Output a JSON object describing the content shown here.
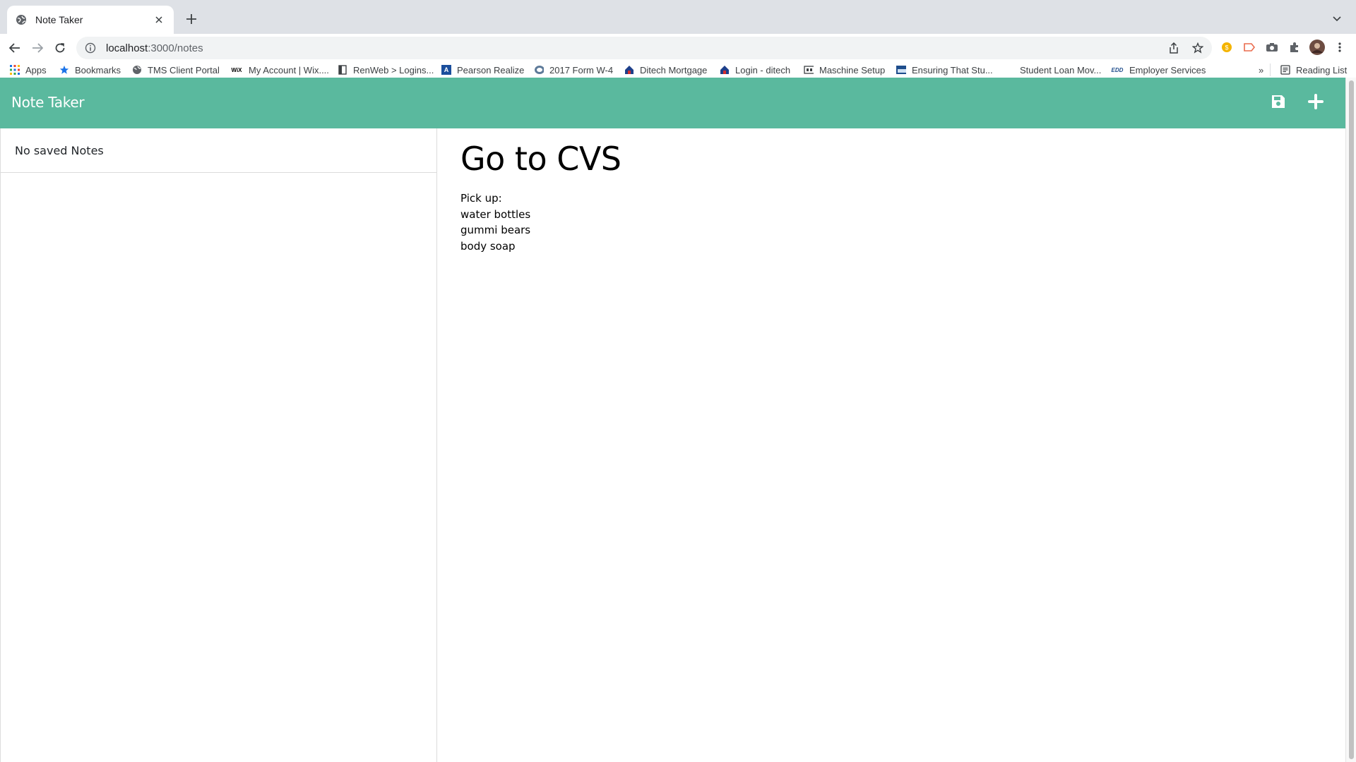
{
  "browser": {
    "tab": {
      "title": "Note Taker",
      "favicon": "globe-icon"
    },
    "url_host": "localhost",
    "url_path": ":3000/notes",
    "bookmarks": [
      {
        "label": "Apps",
        "icon": "apps-grid-icon"
      },
      {
        "label": "Bookmarks",
        "icon": "star-icon"
      },
      {
        "label": "TMS Client Portal",
        "icon": "globe-icon"
      },
      {
        "label": "My Account | Wix....",
        "icon": "wix-icon"
      },
      {
        "label": "RenWeb > Logins...",
        "icon": "page-icon"
      },
      {
        "label": "Pearson Realize",
        "icon": "pearson-icon"
      },
      {
        "label": "2017 Form W-4",
        "icon": "irs-icon"
      },
      {
        "label": "Ditech Mortgage",
        "icon": "house-icon"
      },
      {
        "label": "Login - ditech",
        "icon": "house-icon"
      },
      {
        "label": "Maschine Setup",
        "icon": "maschine-icon"
      },
      {
        "label": "Ensuring That Stu...",
        "icon": "site-icon"
      },
      {
        "label": "Student Loan Mov...",
        "icon": ""
      },
      {
        "label": "Employer Services",
        "icon": "edd-icon"
      }
    ],
    "more_bookmarks": "»",
    "reading_list": "Reading List",
    "colors": {
      "tabstrip": "#dee1e6",
      "omnibox": "#f1f3f4"
    }
  },
  "app": {
    "brand": "Note Taker",
    "nav_color": "#5ab99e",
    "actions": {
      "save_icon": "save-icon",
      "new_icon": "plus-icon"
    },
    "sidebar": {
      "empty_message": "No saved Notes"
    },
    "note": {
      "title": "Go to CVS",
      "lines": [
        "Pick up:",
        "water bottles",
        "gummi bears",
        "body soap"
      ]
    }
  }
}
